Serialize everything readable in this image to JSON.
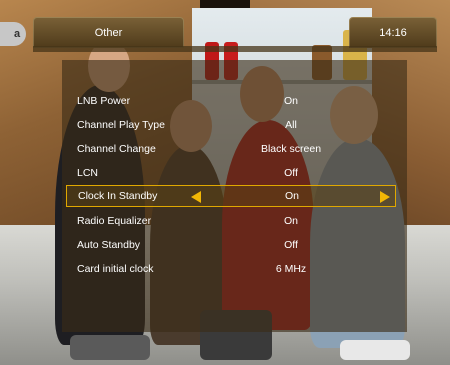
{
  "header": {
    "title": "Other",
    "time": "14:16",
    "channel_badge": "a"
  },
  "menu": {
    "items": [
      {
        "label": "LNB Power",
        "value": "On"
      },
      {
        "label": "Channel Play Type",
        "value": "All"
      },
      {
        "label": "Channel Change",
        "value": "Black screen"
      },
      {
        "label": "LCN",
        "value": "Off"
      },
      {
        "label": "Clock In Standby",
        "value": "On"
      },
      {
        "label": "Radio Equalizer",
        "value": "On"
      },
      {
        "label": "Auto Standby",
        "value": "Off"
      },
      {
        "label": "Card initial clock",
        "value": "6 MHz"
      }
    ]
  },
  "icons": [
    "arrow-left-icon",
    "arrow-right-icon"
  ],
  "colors": {
    "accent": "#f2b705",
    "selection_border": "#e0a800",
    "panel_bg": "#3a2c16",
    "text": "#ffffff"
  }
}
